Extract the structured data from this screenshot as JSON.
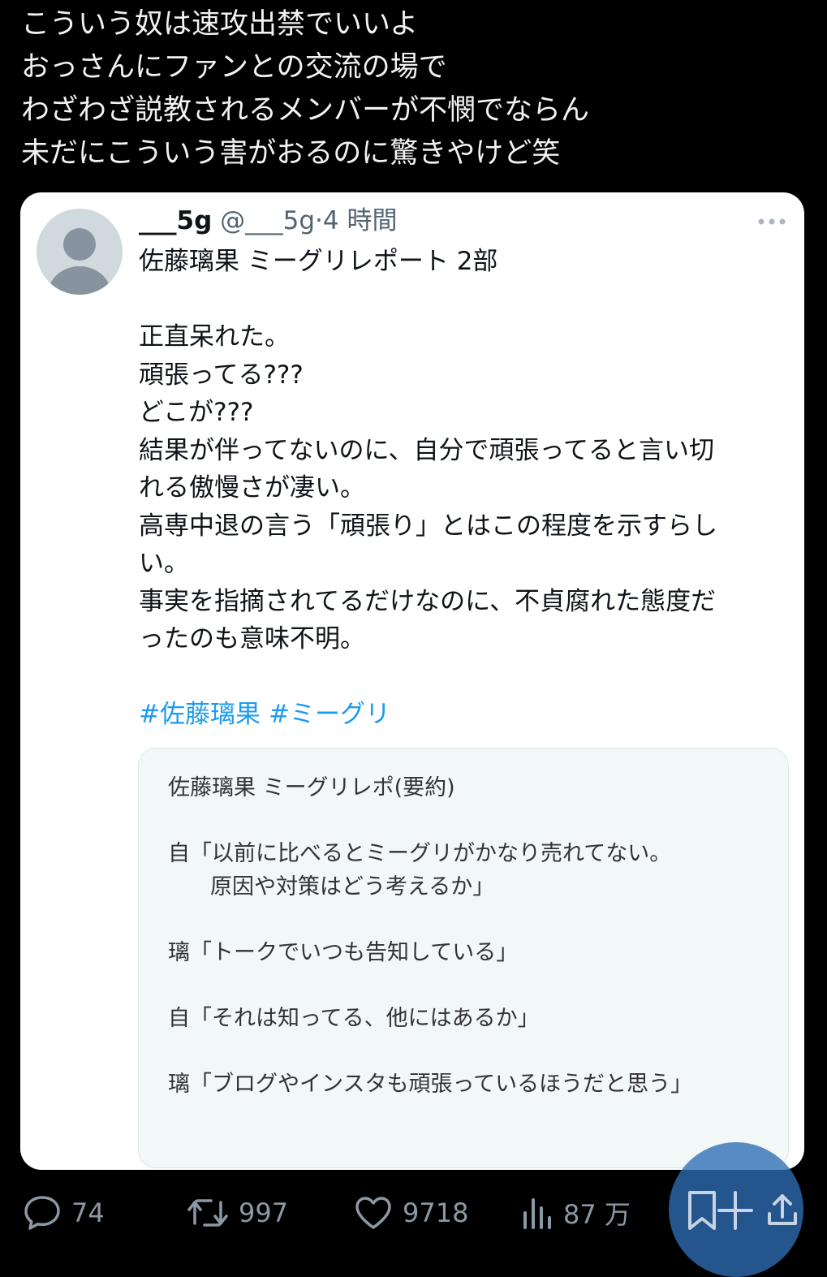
{
  "post": {
    "lines": [
      "こういう奴は速攻出禁でいいよ",
      "おっさんにファンとの交流の場で",
      "わざわざ説教されるメンバーが不憫でならん",
      "未だにこういう害がおるのに驚きやけど笑"
    ]
  },
  "quote": {
    "author_name": "___5g",
    "author_handle": "@___5g",
    "separator": "·",
    "time": "4 時間",
    "more_icon": "more-dots-icon",
    "body_lines": [
      "佐藤璃果 ミーグリレポート 2部",
      "",
      "正直呆れた。",
      "頑張ってる???",
      "どこが???",
      "結果が伴ってないのに、自分で頑張ってると言い切",
      "れる傲慢さが凄い。",
      "高専中退の言う「頑張り」とはこの程度を示すらし",
      "い。",
      "事実を指摘されてるだけなのに、不貞腐れた態度だ",
      "ったのも意味不明。"
    ],
    "hashtags": [
      "#佐藤璃果",
      "#ミーグリ"
    ],
    "embed": {
      "title": "佐藤璃果 ミーグリレポ(要約)",
      "lines": [
        "自「以前に比べるとミーグリがかなり売れてない。",
        "原因や対策はどう考えるか」",
        "璃「トークでいつも告知している」",
        "自「それは知ってる、他にはあるか」",
        "璃「ブログやインスタも頑張っているほうだと思う」"
      ]
    }
  },
  "actions": {
    "reply_count": "74",
    "repost_count": "997",
    "like_count": "9718",
    "views_count": "87 万",
    "icons": [
      "reply-icon",
      "repost-icon",
      "like-icon",
      "views-icon",
      "bookmark-add-icon",
      "share-icon"
    ]
  },
  "colors": {
    "background": "#000000",
    "card": "#ffffff",
    "hashtag": "#1d9bf0",
    "highlight": "#2e6db4",
    "muted": "#71767b"
  }
}
